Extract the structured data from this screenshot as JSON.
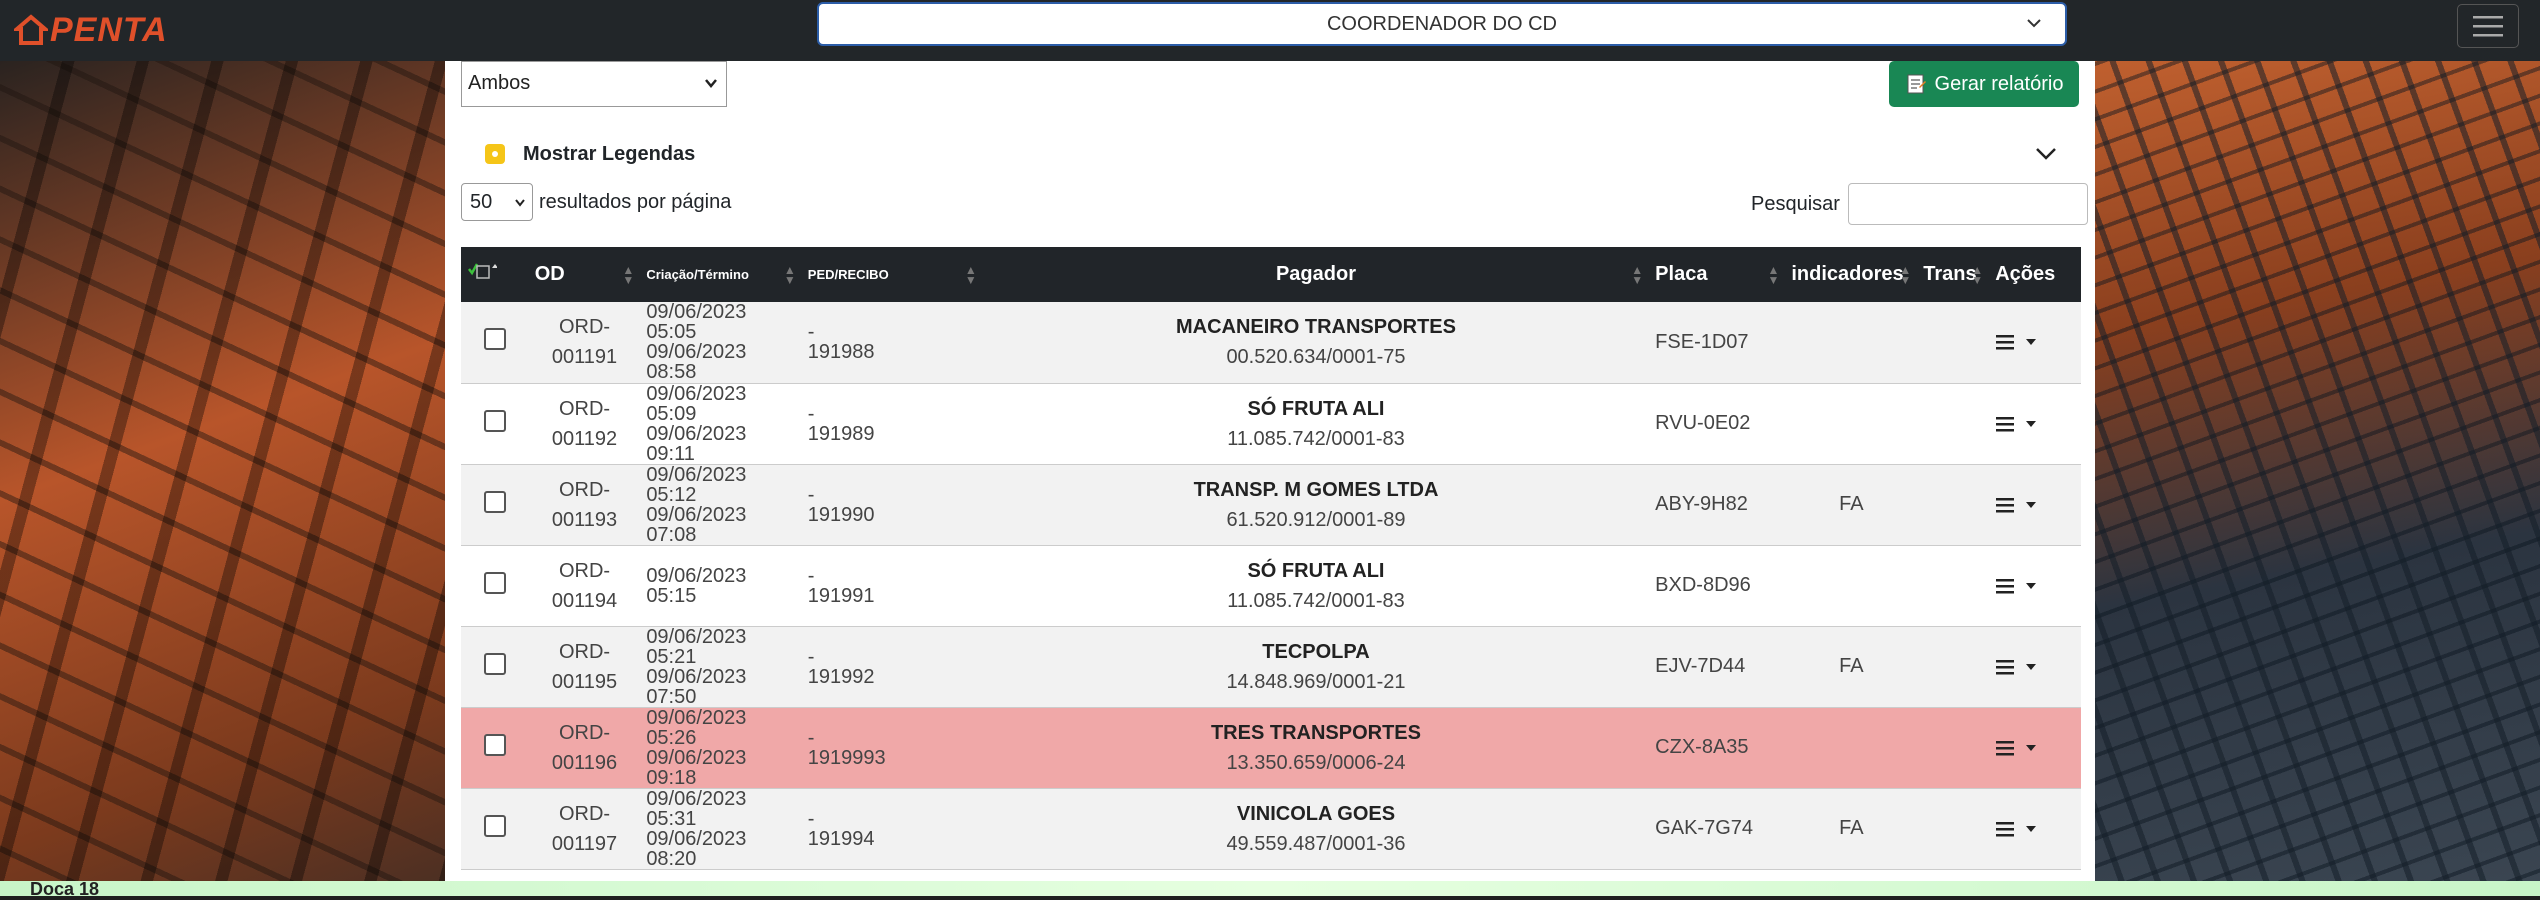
{
  "brand": {
    "name": "PENTA",
    "color": "#e0502a"
  },
  "header": {
    "role_value": "COORDENADOR DO CD"
  },
  "toolbar": {
    "filter_value": "Ambos",
    "report_label": "Gerar relatório"
  },
  "legend": {
    "label": "Mostrar Legendas"
  },
  "pagination": {
    "page_size": "50",
    "page_size_suffix": "resultados por página"
  },
  "search": {
    "label": "Pesquisar",
    "value": ""
  },
  "table": {
    "columns": {
      "od": "OD",
      "dates": "Criação/Término",
      "ped": "PED/RECIBO",
      "pagador": "Pagador",
      "placa": "Placa",
      "indicadores": "indicadores",
      "trans": "Trans",
      "acoes": "Ações"
    },
    "rows": [
      {
        "od1": "ORD-",
        "od2": "001191",
        "d1": "09/06/2023 05:05",
        "d2": "09/06/2023 08:58",
        "p1": "-",
        "p2": "191988",
        "name": "MACANEIRO TRANSPORTES",
        "cnpj": "00.520.634/0001-75",
        "placa": "FSE-1D07",
        "ind": ""
      },
      {
        "od1": "ORD-",
        "od2": "001192",
        "d1": "09/06/2023 05:09",
        "d2": "09/06/2023 09:11",
        "p1": "-",
        "p2": "191989",
        "name": "SÓ FRUTA ALI",
        "cnpj": "11.085.742/0001-83",
        "placa": "RVU-0E02",
        "ind": ""
      },
      {
        "od1": "ORD-",
        "od2": "001193",
        "d1": "09/06/2023 05:12",
        "d2": "09/06/2023 07:08",
        "p1": "-",
        "p2": "191990",
        "name": "TRANSP. M GOMES LTDA",
        "cnpj": "61.520.912/0001-89",
        "placa": "ABY-9H82",
        "ind": "FA"
      },
      {
        "od1": "ORD-",
        "od2": "001194",
        "d1": "09/06/2023 05:15",
        "d2": "",
        "p1": "-",
        "p2": "191991",
        "name": "SÓ FRUTA ALI",
        "cnpj": "11.085.742/0001-83",
        "placa": "BXD-8D96",
        "ind": ""
      },
      {
        "od1": "ORD-",
        "od2": "001195",
        "d1": "09/06/2023 05:21",
        "d2": "09/06/2023 07:50",
        "p1": "-",
        "p2": "191992",
        "name": "TECPOLPA",
        "cnpj": "14.848.969/0001-21",
        "placa": "EJV-7D44",
        "ind": "FA"
      },
      {
        "od1": "ORD-",
        "od2": "001196",
        "d1": "09/06/2023 05:26",
        "d2": "09/06/2023 09:18",
        "p1": "-",
        "p2": "1919993",
        "name": "TRES TRANSPORTES",
        "cnpj": "13.350.659/0006-24",
        "placa": "CZX-8A35",
        "ind": ""
      },
      {
        "od1": "ORD-",
        "od2": "001197",
        "d1": "09/06/2023 05:31",
        "d2": "09/06/2023 08:20",
        "p1": "-",
        "p2": "191994",
        "name": "VINICOLA GOES",
        "cnpj": "49.559.487/0001-36",
        "placa": "GAK-7G74",
        "ind": "FA"
      }
    ]
  },
  "footer": {
    "label": "Doca 18"
  },
  "colors": {
    "report_button": "#198754",
    "alert_row": "#f0a8a8",
    "header_row": "#212529"
  }
}
